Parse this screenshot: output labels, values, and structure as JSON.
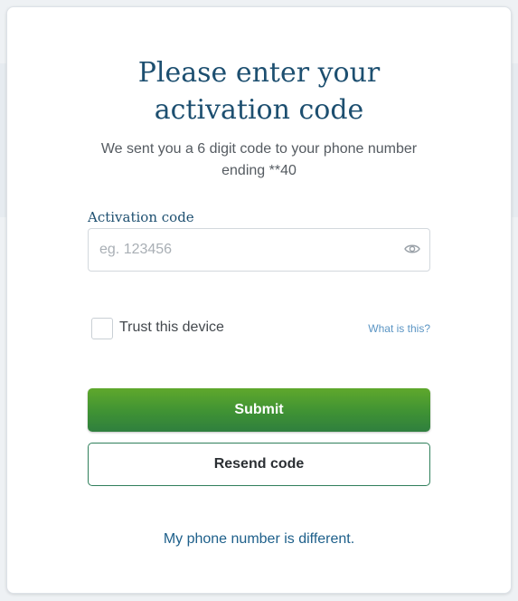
{
  "heading": {
    "line1": "Please enter your",
    "line2": "activation code"
  },
  "subtitle": {
    "line1": "We sent you a 6 digit code to your phone number",
    "line2": "ending **40"
  },
  "activation_field": {
    "label": "Activation code",
    "value": "",
    "placeholder": "eg. 123456",
    "icon": "eye-icon"
  },
  "trust_device": {
    "label": "Trust this device",
    "checked": false,
    "help_link": "What is this?"
  },
  "buttons": {
    "submit_label": "Submit",
    "resend_label": "Resend code"
  },
  "footer_link": "My phone number is different.",
  "colors": {
    "heading": "#1d4f70",
    "submit_top": "#5fa82c",
    "submit_bottom": "#2f7f3e",
    "link": "#1d5f8a"
  }
}
